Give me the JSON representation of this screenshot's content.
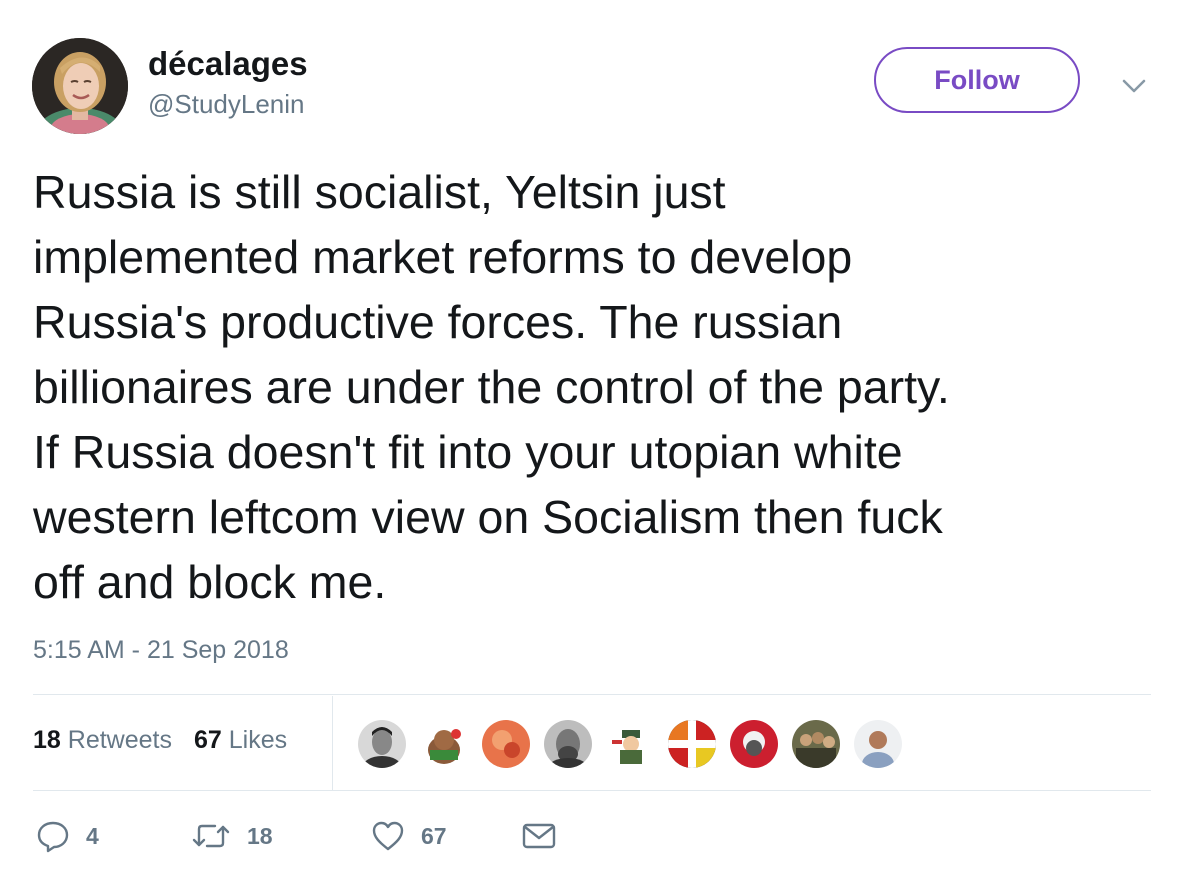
{
  "user": {
    "display_name": "décalages",
    "handle": "@StudyLenin",
    "avatar_icon": "profile-photo-woman-blonde"
  },
  "follow_button": {
    "label": "Follow",
    "color": "#794bc4"
  },
  "tweet": {
    "text": "Russia is still socialist, Yeltsin just\nimplemented market reforms to develop\nRussia's productive forces. The russian\nbillionaires are under the control of the party.\nIf Russia doesn't fit into your utopian white\nwestern leftcom view on Socialism then fuck\noff and block me.",
    "timestamp": "5:15 AM - 21 Sep 2018"
  },
  "stats": {
    "retweets_count": "18",
    "retweets_label": "Retweets",
    "likes_count": "67",
    "likes_label": "Likes"
  },
  "likers": [
    {
      "icon": "avatar-man-bw-portrait"
    },
    {
      "icon": "avatar-cartoon-bear"
    },
    {
      "icon": "avatar-orange-red"
    },
    {
      "icon": "avatar-grey-bearded-man"
    },
    {
      "icon": "avatar-cartoon-saluting-soldier"
    },
    {
      "icon": "avatar-flag-cross"
    },
    {
      "icon": "avatar-red-circle-portrait"
    },
    {
      "icon": "avatar-group-photo"
    },
    {
      "icon": "avatar-man-light-background"
    }
  ],
  "actions": {
    "reply_count": "4",
    "retweet_count": "18",
    "like_count": "67"
  },
  "colors": {
    "text": "#14171a",
    "secondary_text": "#657786",
    "divider": "#e1e8ed",
    "accent": "#794bc4"
  }
}
